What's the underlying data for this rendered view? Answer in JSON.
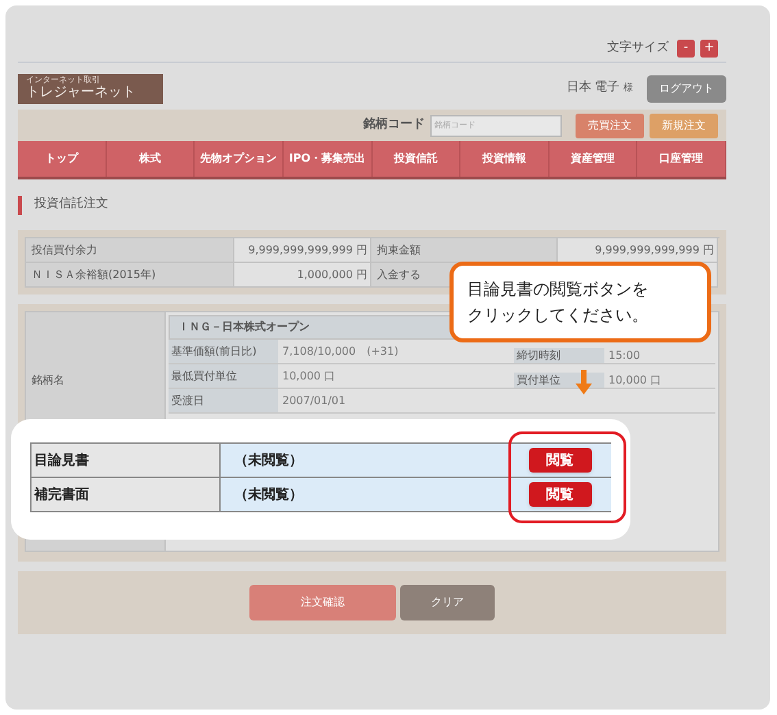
{
  "font_size": {
    "label": "文字サイズ",
    "decrease": "-",
    "increase": "+"
  },
  "logo": {
    "tagline": "インターネット取引",
    "name": "トレジャーネット"
  },
  "user": {
    "name": "日本 電子",
    "honorific": "様"
  },
  "logout": "ログアウト",
  "search": {
    "label": "銘柄コード",
    "placeholder": "銘柄コード",
    "buttons": [
      "売買注文",
      "新規注文"
    ]
  },
  "nav": [
    "トップ",
    "株式",
    "先物オプション",
    "IPO・募集売出",
    "投資信託",
    "投資情報",
    "資産管理",
    "口座管理"
  ],
  "page_title": "投資信託注文",
  "balance": [
    {
      "label": "投信買付余力",
      "value": "9,999,999,999,999 円",
      "label_2": "拘束金額",
      "value_2": "9,999,999,999,999 円"
    },
    {
      "label": "ＮＩＳＡ余裕額(2015年)",
      "value": "1,000,000 円",
      "label_2": "入金する"
    }
  ],
  "fund": {
    "label": "銘柄名",
    "name": "ＩＮＧ－日本株式オープン",
    "details": [
      {
        "label": "基準価額(前日比)",
        "value": "7,108/10,000　(+31)",
        "side_label": "締切時刻",
        "side_value": "15:00"
      },
      {
        "label": "最低買付単位",
        "value": "10,000 口",
        "side_label": "買付単位",
        "side_value": "10,000 口"
      },
      {
        "label": "受渡日",
        "value": "2007/01/01"
      }
    ]
  },
  "documents": [
    {
      "label": "目論見書",
      "status": "（未閲覧）",
      "button": "閲覧"
    },
    {
      "label": "補完書面",
      "status": "（未閲覧）",
      "button": "閲覧"
    }
  ],
  "actions": [
    "注文確認",
    "クリア"
  ],
  "callout": [
    "目論見書の閲覧ボタンを",
    "クリックしてください。"
  ]
}
